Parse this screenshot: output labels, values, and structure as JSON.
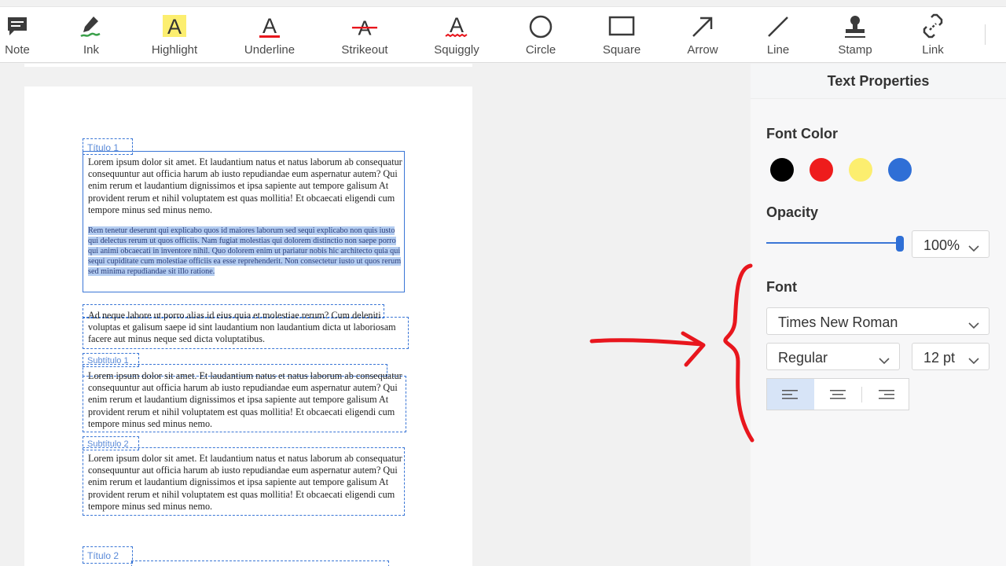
{
  "toolbar": {
    "tools": [
      {
        "id": "note",
        "label": "Note",
        "icon": "note-icon"
      },
      {
        "id": "ink",
        "label": "Ink",
        "icon": "pen-icon"
      },
      {
        "id": "highlight",
        "label": "Highlight",
        "icon": "highlight-icon",
        "glyph": "A"
      },
      {
        "id": "underline",
        "label": "Underline",
        "icon": "underline-icon",
        "glyph": "A"
      },
      {
        "id": "strikeout",
        "label": "Strikeout",
        "icon": "strikeout-icon",
        "glyph": "A"
      },
      {
        "id": "squiggly",
        "label": "Squiggly",
        "icon": "squiggly-icon",
        "glyph": "A"
      },
      {
        "id": "circle",
        "label": "Circle",
        "icon": "circle-icon"
      },
      {
        "id": "square",
        "label": "Square",
        "icon": "square-icon"
      },
      {
        "id": "arrow",
        "label": "Arrow",
        "icon": "arrow-icon"
      },
      {
        "id": "line",
        "label": "Line",
        "icon": "line-icon"
      },
      {
        "id": "stamp",
        "label": "Stamp",
        "icon": "stamp-icon"
      },
      {
        "id": "link",
        "label": "Link",
        "icon": "link-icon"
      }
    ]
  },
  "document": {
    "heading1": "Título 1",
    "para1": "Lorem ipsum dolor sit amet. Et laudantium natus et natus laborum ab consequatur consequuntur aut officia harum ab iusto repudiandae eum aspernatur autem? Qui enim rerum et laudantium dignissimos et ipsa sapiente aut tempore galisum At provident rerum et nihil voluptatem est quas mollitia! Et obcaecati eligendi cum tempore minus sed minus nemo.",
    "para2": "Rem tenetur deserunt qui explicabo quos id maiores laborum sed sequi explicabo non quis iusto qui delectus rerum ut quos officiis. Nam fugiat molestias qui dolorem distinctio non saepe porro qui animi obcaecati in inventore nihil. Quo dolorem enim ut pariatur nobis hic architecto quia qui sequi cupiditate cum molestiae officiis ea esse reprehenderit. Non consectetur iusto ut quos rerum sed minima repudiandae sit illo ratione.",
    "para3": "Ad neque labore ut porro alias id eius quia et molestiae rerum? Cum deleniti voluptas et galisum saepe id sint laudantium non laudantium dicta ut laboriosam facere aut minus neque sed dicta voluptatibus.",
    "subtitle1": "Subtítulo 1",
    "para4": "Lorem ipsum dolor sit amet. Et laudantium natus et natus laborum ab consequatur consequuntur aut officia harum ab iusto repudiandae eum aspernatur autem? Qui enim rerum et laudantium dignissimos et ipsa sapiente aut tempore galisum At provident rerum et nihil voluptatem est quas mollitia! Et obcaecati eligendi cum tempore minus sed minus nemo.",
    "subtitle2": "Subtítulo 2",
    "para5": "Lorem ipsum dolor sit amet. Et laudantium natus et natus laborum ab consequatur consequuntur aut officia harum ab iusto repudiandae eum aspernatur autem? Qui enim rerum et laudantium dignissimos et ipsa sapiente aut tempore galisum At provident rerum et nihil voluptatem est quas mollitia! Et obcaecati eligendi cum tempore minus sed minus nemo.",
    "heading2": "Título 2"
  },
  "panel": {
    "title": "Text Properties",
    "font_color_label": "Font Color",
    "colors": [
      "#000000",
      "#ee1c1c",
      "#fcee6f",
      "#2f6fd6"
    ],
    "opacity_label": "Opacity",
    "opacity_value": "100%",
    "opacity": 1.0,
    "font_label": "Font",
    "font_family": "Times New Roman",
    "font_style": "Regular",
    "font_size": "12 pt",
    "alignment_options": [
      "left",
      "center",
      "right"
    ],
    "alignment_selected": "left"
  },
  "colors": {
    "accent": "#3a76d6",
    "annotation": "#e8161d",
    "selection": "#b4cdf1"
  }
}
